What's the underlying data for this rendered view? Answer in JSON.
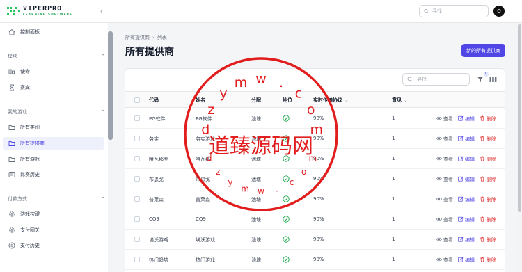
{
  "header": {
    "brand_title": "VIPERPRO",
    "brand_subtitle": "LEARNING SOFTWARE",
    "search_placeholder": "寻找",
    "avatar_initial": "O"
  },
  "sidebar": {
    "items_top": [
      {
        "label": "控制面板",
        "icon": "home-icon"
      }
    ],
    "groups": [
      {
        "label": "模块",
        "items": [
          {
            "label": "使命",
            "icon": "mission-icon"
          },
          {
            "label": "赛宾",
            "icon": "hourglass-icon"
          }
        ]
      },
      {
        "label": "我的游戏",
        "items": [
          {
            "label": "所有类别",
            "icon": "folder-icon"
          },
          {
            "label": "所有提供商",
            "icon": "folder-icon",
            "active": true
          },
          {
            "label": "所有游戏",
            "icon": "folder-icon"
          },
          {
            "label": "比赛历史",
            "icon": "list-icon"
          }
        ]
      },
      {
        "label": "付款方式",
        "items": [
          {
            "label": "游戏按键",
            "icon": "gear-icon"
          },
          {
            "label": "支付网关",
            "icon": "gear-icon"
          },
          {
            "label": "支付历史",
            "icon": "dollar-icon"
          }
        ]
      }
    ]
  },
  "page": {
    "breadcrumb": [
      "所有提供商",
      "列表"
    ],
    "title": "所有提供商",
    "new_button": "新的所有提供商"
  },
  "table": {
    "search_placeholder": "寻找",
    "filter_count": "0",
    "columns": [
      "代码",
      "姓名",
      "分配",
      "地位",
      "实时传输协议",
      "意见"
    ],
    "actions": {
      "view": "查看",
      "edit": "编辑",
      "delete": "删除"
    },
    "rows": [
      {
        "code": "PG软件",
        "name": "PG软件",
        "assign": "池塘",
        "rtp": "90%",
        "views": "1"
      },
      {
        "code": "务实",
        "name": "务实游戏",
        "assign": "池塘",
        "rtp": "90%",
        "views": "1"
      },
      {
        "code": "哈瓦那罗",
        "name": "哈瓦那",
        "assign": "池塘",
        "rtp": "90%",
        "views": "1"
      },
      {
        "code": "布恩戈",
        "name": "布恩戈",
        "assign": "池塘",
        "rtp": "90%",
        "views": "1"
      },
      {
        "code": "普莱森",
        "name": "普莱森",
        "assign": "池塘",
        "rtp": "90%",
        "views": "1"
      },
      {
        "code": "CQ9",
        "name": "CQ9",
        "assign": "池塘",
        "rtp": "90%",
        "views": "1"
      },
      {
        "code": "埃沃游戏",
        "name": "埃沃游戏",
        "assign": "池塘",
        "rtp": "90%",
        "views": "1"
      },
      {
        "code": "热门趋势",
        "name": "热门游戏",
        "assign": "池塘",
        "rtp": "90%",
        "views": "1"
      }
    ]
  },
  "watermark": {
    "center_text": "道臻源码网",
    "ring_text": "dzymw.com"
  },
  "colors": {
    "accent": "#4f46e5",
    "success": "#16a34a",
    "danger": "#dc2626",
    "watermark": "#e11d1d"
  }
}
